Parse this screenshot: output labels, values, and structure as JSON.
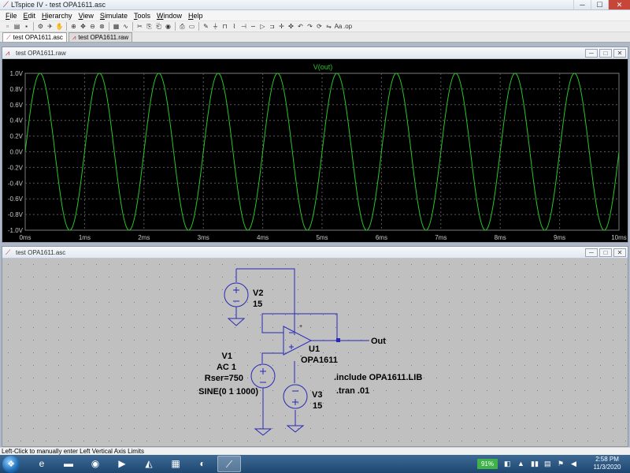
{
  "window": {
    "title": "LTspice IV - test OPA1611.asc",
    "min": "─",
    "max": "☐",
    "close": "✕"
  },
  "menu": [
    {
      "label": "File",
      "key": "F",
      "rest": "ile"
    },
    {
      "label": "Edit",
      "key": "E",
      "rest": "dit"
    },
    {
      "label": "Hierarchy",
      "key": "H",
      "rest": "ierarchy"
    },
    {
      "label": "View",
      "key": "V",
      "rest": "iew"
    },
    {
      "label": "Simulate",
      "key": "S",
      "rest": "imulate"
    },
    {
      "label": "Tools",
      "key": "T",
      "rest": "ools"
    },
    {
      "label": "Window",
      "key": "W",
      "rest": "indow"
    },
    {
      "label": "Help",
      "key": "H",
      "rest": "elp"
    }
  ],
  "toolbar_icons": [
    "new-schematic-icon",
    "open-icon",
    "save-icon",
    "|",
    "control-panel-icon",
    "run-icon",
    "halt-icon",
    "|",
    "zoom-in-icon",
    "pan-icon",
    "zoom-out-icon",
    "zoom-fit-icon",
    "|",
    "autorange-icon",
    "waveform-icon",
    "|",
    "cut-icon",
    "copy-icon",
    "paste-icon",
    "find-icon",
    "|",
    "print-icon",
    "print-preview-icon",
    "|",
    "draw-wire-icon",
    "ground-icon",
    "label-net-icon",
    "resistor-icon",
    "capacitor-icon",
    "inductor-icon",
    "diode-icon",
    "component-icon",
    "move-icon",
    "drag-icon",
    "undo-icon",
    "redo-icon",
    "rotate-icon",
    "mirror-icon",
    "text-icon",
    "spice-directive-icon"
  ],
  "toolbar_glyphs": [
    "▫",
    "▤",
    "▪",
    "|",
    "⚙",
    "✈",
    "✋",
    "|",
    "⊕",
    "✥",
    "⊖",
    "⊗",
    "|",
    "▦",
    "∿",
    "|",
    "✂",
    "⎘",
    "⎗",
    "◉",
    "|",
    "⎙",
    "▭",
    "|",
    "✎",
    "⏚",
    "⊓",
    "⌇",
    "⊣",
    "∽",
    "▷",
    "⊐",
    "✛",
    "✜",
    "↶",
    "↷",
    "⟳",
    "⇋",
    "Aa",
    ".op"
  ],
  "tabs": [
    {
      "label": "test OPA1611.asc",
      "active": true
    },
    {
      "label": "test OPA1611.raw",
      "active": false
    }
  ],
  "waveform": {
    "title": "test OPA1611.raw",
    "trace_label": "V(out)",
    "bg_color": "#000000",
    "trace_color": "#29c429",
    "grid_color": "#5a5a5a",
    "axis_label_color": "#c8c8c8",
    "y_ticks": [
      "1.0V",
      "0.8V",
      "0.6V",
      "0.4V",
      "0.2V",
      "0.0V",
      "-0.2V",
      "-0.4V",
      "-0.6V",
      "-0.8V",
      "-1.0V"
    ],
    "x_ticks": [
      "0ms",
      "1ms",
      "2ms",
      "3ms",
      "4ms",
      "5ms",
      "6ms",
      "7ms",
      "8ms",
      "9ms",
      "10ms"
    ]
  },
  "chart_data": {
    "type": "line",
    "title": "V(out)",
    "series": [
      {
        "name": "V(out)",
        "function": "sin(2*pi*1000*t)",
        "amplitude": 1,
        "frequency_hz": 1000,
        "offset": 0
      }
    ],
    "xlim_ms": [
      0,
      10
    ],
    "ylim": [
      -1.0,
      1.0
    ],
    "grid": true
  },
  "schematic": {
    "title": "test OPA1611.asc",
    "bg_color": "#c0c0c0",
    "wire_color": "#2828b8",
    "v2": {
      "name": "V2",
      "value": "15"
    },
    "v1": {
      "name": "V1",
      "line1": "AC 1",
      "line2": "Rser=750",
      "line3": "SINE(0 1 1000)"
    },
    "v3": {
      "name": "V3",
      "value": "15"
    },
    "u1": {
      "name": "U1",
      "model": "OPA1611"
    },
    "out_label": "Out",
    "directives": [
      ".include OPA1611.LIB",
      ".tran .01"
    ],
    "pin_plus": "+",
    "pin_minus": "-"
  },
  "mdi_buttons": {
    "min": "─",
    "max": "□",
    "close": "✕"
  },
  "status": "Left-Click to manually enter Left Vertical Axis Limits",
  "taskbar": {
    "start": "❖",
    "icons": [
      {
        "name": "explorer-icon",
        "glyph": "e",
        "active": false
      },
      {
        "name": "file-manager-icon",
        "glyph": "▬",
        "active": false
      },
      {
        "name": "firefox-icon",
        "glyph": "◉",
        "active": false
      },
      {
        "name": "media-player-icon",
        "glyph": "▶",
        "active": false
      },
      {
        "name": "cat-app-icon",
        "glyph": "◭",
        "active": false
      },
      {
        "name": "calculator-icon",
        "glyph": "▦",
        "active": false
      },
      {
        "name": "edge-icon",
        "glyph": "◐",
        "active": false
      },
      {
        "name": "ltspice-icon",
        "glyph": "⟋",
        "active": true
      }
    ],
    "battery": "91%",
    "tray_glyphs": [
      "◧",
      "▲",
      "▮▮",
      "▤",
      "⚑",
      "◀"
    ],
    "time": "2:58 PM",
    "date": "11/3/2020"
  }
}
